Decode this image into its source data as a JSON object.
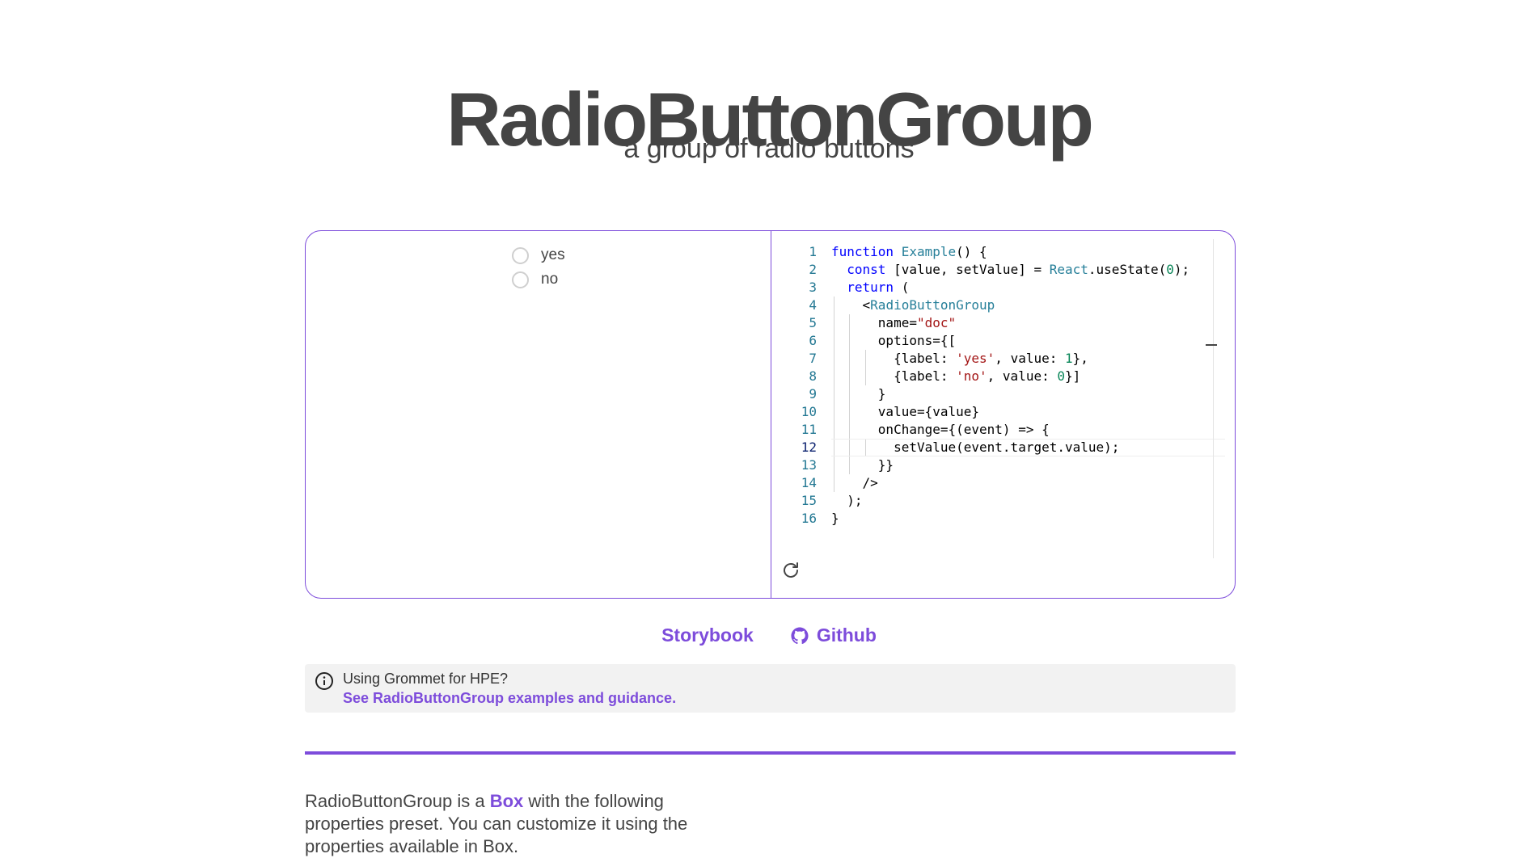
{
  "header": {
    "title": "RadioButtonGroup",
    "subtitle": "a group of radio buttons"
  },
  "preview": {
    "options": [
      {
        "label": "yes",
        "checked": false
      },
      {
        "label": "no",
        "checked": false
      }
    ]
  },
  "code_editor": {
    "active_line": 12,
    "line_numbers": [
      "1",
      "2",
      "3",
      "4",
      "5",
      "6",
      "7",
      "8",
      "9",
      "10",
      "11",
      "12",
      "13",
      "14",
      "15",
      "16"
    ],
    "lines": [
      "function Example() {",
      "  const [value, setValue] = React.useState(0);",
      "  return (",
      "    <RadioButtonGroup",
      "      name=\"doc\"",
      "      options={[",
      "        {label: 'yes', value: 1},",
      "        {label: 'no', value: 0}]",
      "      }",
      "      value={value}",
      "      onChange={(event) => {",
      "        setValue(event.target.value);",
      "      }}",
      "    />",
      "  );",
      "}"
    ]
  },
  "links": {
    "storybook": "Storybook",
    "github": "Github"
  },
  "hpe_note": {
    "question": "Using Grommet for HPE?",
    "link_text": "See RadioButtonGroup examples and guidance."
  },
  "description": {
    "before": "RadioButtonGroup is a ",
    "link": "Box",
    "after": " with the following properties preset. You can customize it using the properties available in Box."
  },
  "colors": {
    "accent": "#7D4CDB",
    "text": "#444444",
    "note_background": "#f2f2f2"
  },
  "icons": {
    "reset": "refresh-icon",
    "github": "github-icon",
    "info": "info-icon"
  }
}
